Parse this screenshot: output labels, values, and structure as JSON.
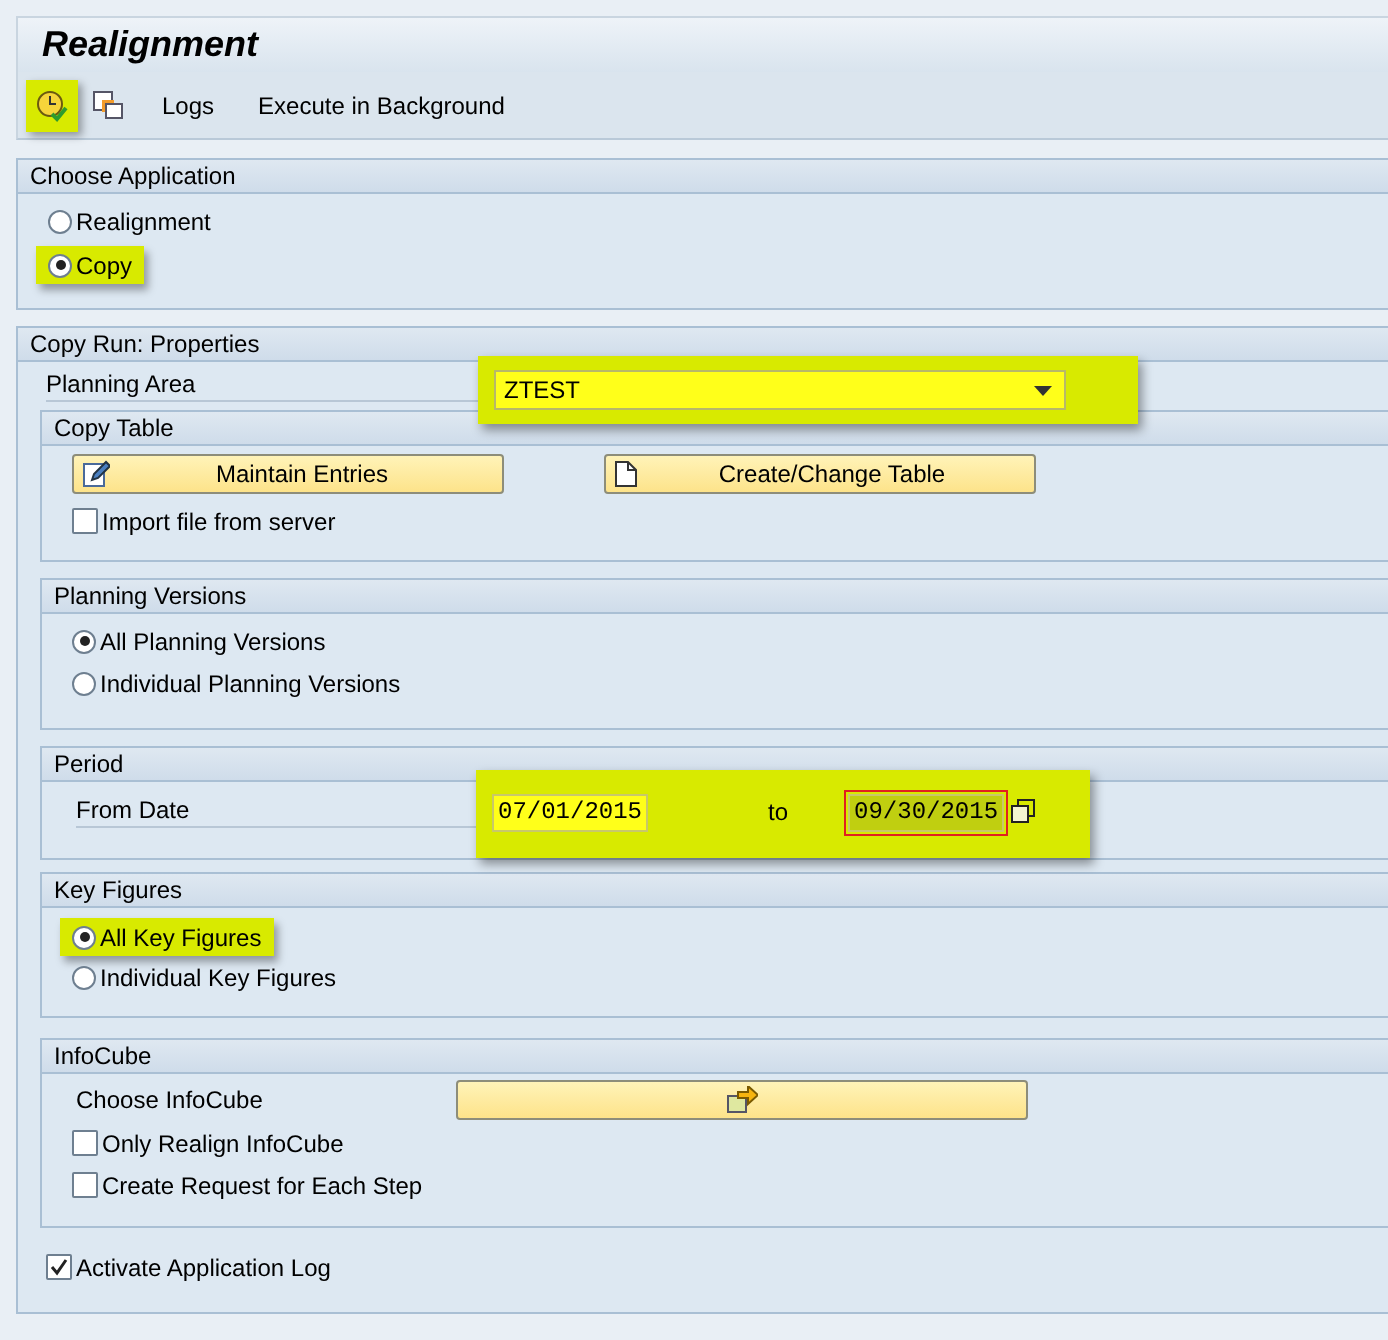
{
  "title": "Realignment",
  "toolbar": {
    "execute_highlighted": true,
    "items": [
      "Logs",
      "Execute in Background"
    ]
  },
  "choose_application": {
    "title": "Choose Application",
    "options": [
      {
        "label": "Realignment",
        "selected": false,
        "highlighted": false
      },
      {
        "label": "Copy",
        "selected": true,
        "highlighted": true
      }
    ]
  },
  "copy_run": {
    "title": "Copy Run: Properties",
    "planning_area": {
      "label": "Planning Area",
      "value": "ZTEST",
      "highlighted": true
    },
    "copy_table": {
      "title": "Copy Table",
      "buttons": [
        "Maintain Entries",
        "Create/Change Table"
      ],
      "import": {
        "label": "Import file from server",
        "checked": false
      }
    },
    "planning_versions": {
      "title": "Planning Versions",
      "options": [
        {
          "label": "All Planning Versions",
          "selected": true,
          "highlighted": false
        },
        {
          "label": "Individual Planning Versions",
          "selected": false,
          "highlighted": false
        }
      ]
    },
    "period": {
      "title": "Period",
      "label": "From Date",
      "from": "07/01/2015",
      "to_label": "to",
      "to": "09/30/2015",
      "highlighted": true
    },
    "key_figures": {
      "title": "Key Figures",
      "options": [
        {
          "label": "All Key Figures",
          "selected": true,
          "highlighted": true
        },
        {
          "label": "Individual Key Figures",
          "selected": false,
          "highlighted": false
        }
      ]
    },
    "infocube": {
      "title": "InfoCube",
      "label": "Choose InfoCube",
      "options": [
        {
          "label": "Only Realign InfoCube",
          "checked": false
        },
        {
          "label": "Create Request for Each Step",
          "checked": false
        }
      ]
    },
    "application_log": {
      "label": "Activate Application Log",
      "checked": true
    }
  }
}
